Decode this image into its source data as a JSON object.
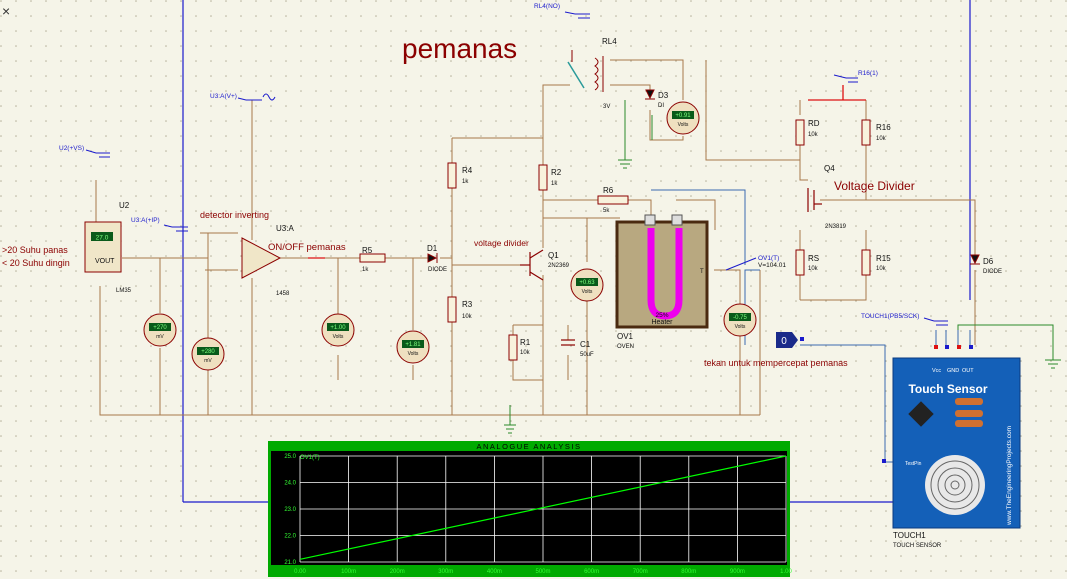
{
  "title": "pemanas",
  "annotations": {
    "rl4_top": "RL4(NO)",
    "u3a_vplus": "U3:A(V+)",
    "u2_vs": "U2(+VS)",
    "u3a_ip": "U3:A(+IP)",
    "detector": "detector inverting",
    "onoff": "ON/OFF pemanas",
    "voltage_divider_small": "voltage divider",
    "voltage_divider_big": "Voltage Divider",
    "r16_1": "R16(1)",
    "ov1_t": "OV1(T)",
    "ov1_v": "V=104.01",
    "touch_pin": "TOUCH1(PB5/SCK)",
    "press_text": "tekan untuk mempercepat pemanas",
    "left_text_1": ">20 Suhu panas",
    "left_text_2": "< 20 Suhu dingin"
  },
  "components": {
    "u2": "U2",
    "u2_vout": "VOUT",
    "u2_part": "LM35",
    "u2_lcd": "27.0",
    "u3a": "U3:A",
    "u3a_part": "1458",
    "rl4": "RL4",
    "rl4_volt": "3V",
    "d3": "D3",
    "d3_part": "DI",
    "r4": "R4",
    "r4_val": "1k",
    "r2": "R2",
    "r2_val": "1k",
    "r6": "R6",
    "r6_val": "5k",
    "r5": "R5",
    "r5_val": "1k",
    "d1": "D1",
    "d1_part": "DIODE",
    "q1": "Q1",
    "q1_part": "2N2369",
    "r3": "R3",
    "r3_val": "10k",
    "r1": "R1",
    "r1_val": "10k",
    "c1": "C1",
    "c1_val": "50uF",
    "ov1": "OV1",
    "ov1_part": "OVEN",
    "heater_pct": "25%",
    "heater": "Heater",
    "rd": "RD",
    "rd_val": "10k",
    "r16": "R16",
    "r16_val": "10k",
    "q4": "Q4",
    "q4_part": "2N3819",
    "rs": "RS",
    "rs_val": "10k",
    "r15": "R15",
    "r15_val": "10k",
    "d6": "D6",
    "d6_part": "DIODE",
    "touch1": "TOUCH1",
    "touch1_part": "TOUCH SENSOR",
    "logic_probe": "0"
  },
  "meters": {
    "m_mv1": {
      "value": "+270",
      "unit": "mV"
    },
    "m_mv2": {
      "value": "+280",
      "unit": "mV"
    },
    "m_v1": {
      "value": "+1.00",
      "unit": "Volts"
    },
    "m_v2": {
      "value": "+1.81",
      "unit": "Volts"
    },
    "m_v3": {
      "value": "+0.63",
      "unit": "Volts"
    },
    "m_v4": {
      "value": "+0.91",
      "unit": "Volts"
    },
    "m_v5": {
      "value": "-0.75",
      "unit": "Volts"
    }
  },
  "touch_sensor": {
    "title": "Touch Sensor",
    "pins": [
      "Vcc",
      "GND",
      "OUT"
    ],
    "brand": "www.TheEngineeringProjects.com",
    "test_pin": "TestPin"
  },
  "chart_data": {
    "type": "line",
    "title": "ANALOGUE ANALYSIS",
    "x": [
      0.0,
      1.0
    ],
    "series": [
      {
        "name": "OV1(T)",
        "values": [
          21.1,
          25.0
        ]
      }
    ],
    "xlim": [
      0.0,
      1.0
    ],
    "ylim": [
      21.0,
      25.0
    ],
    "xticks": [
      "0.00",
      "100m",
      "200m",
      "300m",
      "400m",
      "500m",
      "600m",
      "700m",
      "800m",
      "900m",
      "1.00"
    ],
    "yticks": [
      "21.0",
      "22.0",
      "23.0",
      "24.0",
      "25.0"
    ],
    "grid": true,
    "colors": {
      "background": "#000000",
      "frame": "#00aa00",
      "grid": "#ffffff",
      "line": "#00ff00",
      "text": "#33ff33"
    }
  }
}
